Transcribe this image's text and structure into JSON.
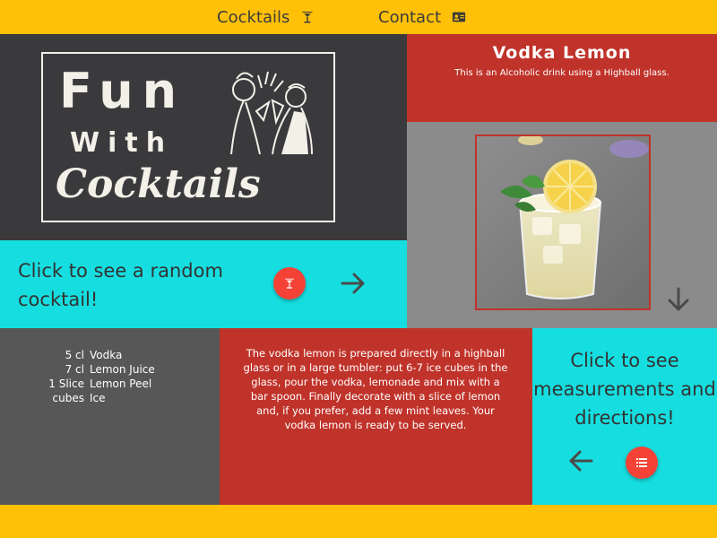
{
  "nav": {
    "cocktails_label": "Cocktails",
    "contact_label": "Contact",
    "cocktails_icon": "martini-glass-icon",
    "contact_icon": "id-card-icon"
  },
  "logo": {
    "line1": "Fun",
    "line2": "With",
    "line3": "Cocktails"
  },
  "random": {
    "text": "Click to see a random cocktail!",
    "button_icon": "martini-glass-icon",
    "arrow_icon": "arrow-right-icon"
  },
  "drink": {
    "name": "Vodka Lemon",
    "subtitle": "This is an Alcoholic drink using a Highball glass.",
    "image_alt": "vodka-lemon-photo"
  },
  "ingredients": [
    {
      "amount": "5 cl",
      "name": "Vodka"
    },
    {
      "amount": "7 cl",
      "name": "Lemon Juice"
    },
    {
      "amount": "1 Slice",
      "name": "Lemon Peel"
    },
    {
      "amount": "cubes",
      "name": "Ice"
    }
  ],
  "directions": {
    "text": "The vodka lemon is prepared directly in a highball glass or in a large tumbler: put 6-7 ice cubes in the glass, pour the vodka, lemonade and mix with a bar spoon. Finally decorate with a slice of lemon and, if you prefer, add a few mint leaves. Your vodka lemon is ready to be served."
  },
  "measurements": {
    "text": "Click to see measurements and directions!",
    "arrow_icon": "arrow-left-icon",
    "button_icon": "list-icon"
  },
  "colors": {
    "accent_yellow": "#FFC107",
    "cyan": "#16DEE0",
    "red": "#C0332A",
    "fab_red": "#F44336",
    "dark": "#3a3a3d",
    "gray": "#8b8b8b"
  }
}
